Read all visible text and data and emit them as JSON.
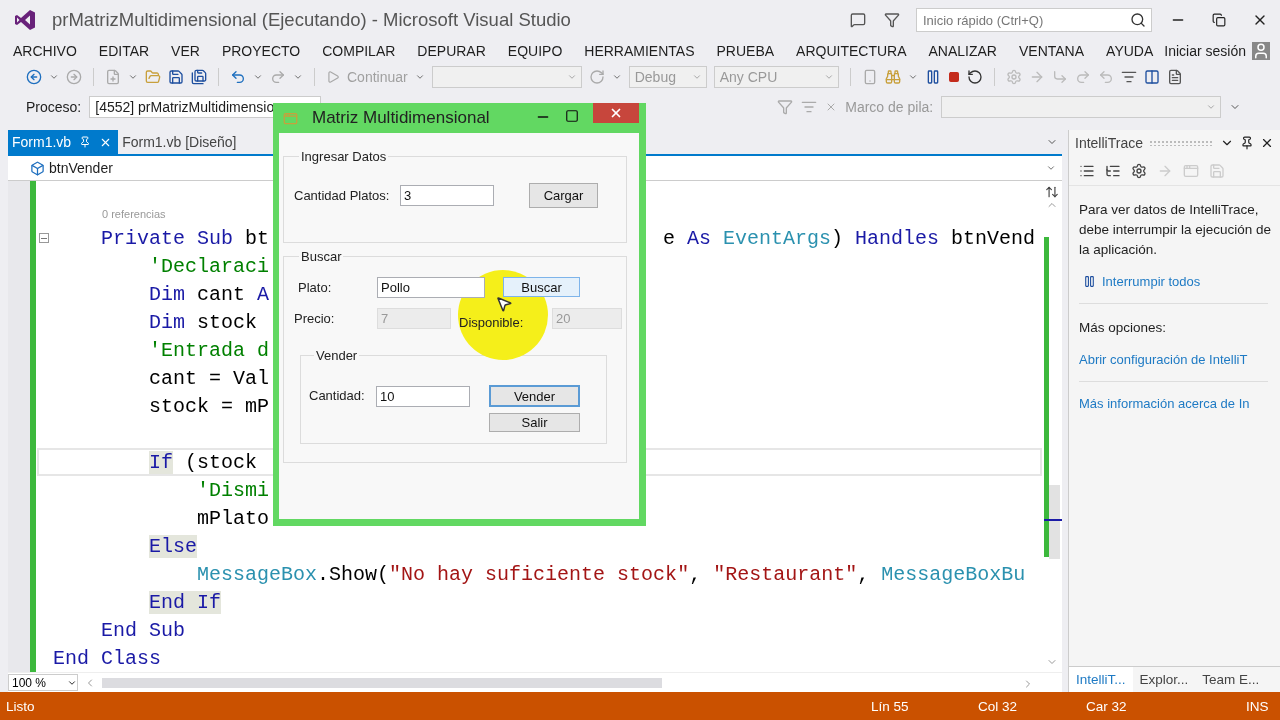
{
  "window": {
    "title": "prMatrizMultidimensional (Ejecutando) - Microsoft Visual Studio",
    "quick_launch": {
      "placeholder": "Inicio rápido (Ctrl+Q)"
    }
  },
  "menu": [
    "ARCHIVO",
    "EDITAR",
    "VER",
    "PROYECTO",
    "COMPILAR",
    "DEPURAR",
    "EQUIPO",
    "HERRAMIENTAS",
    "PRUEBA",
    "ARQUITECTURA",
    "ANALIZAR",
    "VENTANA",
    "AYUDA"
  ],
  "sign_in": "Iniciar sesión",
  "toolbar": {
    "continue": {
      "label": "Continuar",
      "disabled": true
    },
    "configuration": {
      "value": "Debug",
      "disabled": true
    },
    "platform": {
      "value": "Any CPU",
      "disabled": true
    }
  },
  "debug_bar": {
    "process_label": "Proceso:",
    "process": "[4552] prMatrizMultidimensio",
    "stack_label": "Marco de pila:"
  },
  "editor": {
    "tabs": [
      {
        "label": "Form1.vb",
        "selected": true
      },
      {
        "label": "Form1.vb [Diseño]",
        "selected": false
      }
    ],
    "member": "btnVender",
    "codelens": "0 referencias",
    "lines": [
      {
        "tokens": [
          {
            "kind": "keyword",
            "text": "    Private Sub "
          },
          {
            "kind": "plain",
            "text": "bt"
          }
        ],
        "tail": [
          {
            "kind": "plain",
            "text": "e "
          },
          {
            "kind": "keyword",
            "text": "As "
          },
          {
            "kind": "type",
            "text": "EventArgs"
          },
          {
            "kind": "plain",
            "text": ") "
          },
          {
            "kind": "keyword",
            "text": "Handles "
          },
          {
            "kind": "plain",
            "text": "btnVend"
          }
        ],
        "current": false,
        "foldable": true
      },
      {
        "tokens": [
          {
            "kind": "comment",
            "text": "        'Declaraci"
          }
        ],
        "current": false,
        "foldable": false
      },
      {
        "tokens": [
          {
            "kind": "keyword",
            "text": "        Dim "
          },
          {
            "kind": "plain",
            "text": "cant "
          },
          {
            "kind": "keyword",
            "text": "A"
          }
        ],
        "current": false,
        "foldable": false
      },
      {
        "tokens": [
          {
            "kind": "keyword",
            "text": "        Dim "
          },
          {
            "kind": "plain",
            "text": "stock"
          }
        ],
        "current": false,
        "foldable": false
      },
      {
        "tokens": [
          {
            "kind": "comment",
            "text": "        'Entrada d"
          }
        ],
        "current": false,
        "foldable": false
      },
      {
        "tokens": [
          {
            "kind": "plain",
            "text": "        cant = Val"
          }
        ],
        "current": false,
        "foldable": false
      },
      {
        "tokens": [
          {
            "kind": "plain",
            "text": "        stock = mP"
          }
        ],
        "current": false,
        "foldable": false
      },
      {
        "current": false,
        "foldable": false
      },
      {
        "tokens": [
          {
            "kind": "marked",
            "text": "        If"
          },
          {
            "kind": "plain",
            "text": " (stock"
          }
        ],
        "current": true,
        "foldable": false
      },
      {
        "tokens": [
          {
            "kind": "comment",
            "text": "            'Dismi"
          }
        ],
        "current": false,
        "foldable": false
      },
      {
        "tokens": [
          {
            "kind": "plain",
            "text": "            mPlato"
          }
        ],
        "current": false,
        "foldable": false
      },
      {
        "tokens": [
          {
            "kind": "marked",
            "text": "        Else"
          }
        ],
        "current": false,
        "foldable": false
      },
      {
        "tokens": [
          {
            "kind": "type",
            "text": "            MessageBox"
          },
          {
            "kind": "plain",
            "text": ".Show("
          },
          {
            "kind": "string",
            "text": "\"No hay suficiente stock\""
          },
          {
            "kind": "plain",
            "text": ", "
          },
          {
            "kind": "string",
            "text": "\"Restaurant\""
          },
          {
            "kind": "plain",
            "text": ", "
          },
          {
            "kind": "type",
            "text": "MessageBoxBu"
          }
        ],
        "current": false,
        "foldable": false
      },
      {
        "tokens": [
          {
            "kind": "marked",
            "text": "        End If"
          }
        ],
        "current": false,
        "foldable": false
      },
      {
        "tokens": [
          {
            "kind": "keyword",
            "text": "    End Sub"
          }
        ],
        "current": false,
        "foldable": false
      },
      {
        "tokens": [
          {
            "kind": "keyword",
            "text": "End Class"
          }
        ],
        "current": false,
        "foldable": false
      }
    ],
    "zoom": "100 %"
  },
  "intellitrace": {
    "title": "IntelliTrace",
    "message": "Para ver datos de IntelliTrace, debe interrumpir la ejecución de la aplicación.",
    "break_link": "Interrumpir todos",
    "more_label": "Más opciones:",
    "links": [
      "Abrir configuración de IntelliT",
      "Más información acerca de In"
    ],
    "tabs": [
      {
        "label": "IntelliT...",
        "selected": true
      },
      {
        "label": "Explor...",
        "selected": false
      },
      {
        "label": "Team E...",
        "selected": false
      }
    ]
  },
  "dialog": {
    "title": "Matriz Multidimensional",
    "input_group": {
      "title": "Ingresar Datos",
      "field": {
        "label": "Cantidad Platos:",
        "value": "3",
        "disabled": false
      },
      "button": {
        "label": "Cargar",
        "hovered": false,
        "default": false
      }
    },
    "search_group": {
      "title": "Buscar",
      "dish": {
        "label": "Plato:",
        "value": "Pollo",
        "disabled": false
      },
      "button": {
        "label": "Buscar",
        "hovered": true,
        "default": false
      },
      "price": {
        "label": "Precio:",
        "value": "7",
        "disabled": true
      },
      "stock": {
        "label": "Disponible:",
        "value": "20",
        "disabled": true
      },
      "sell_group": {
        "title": "Vender",
        "field": {
          "label": "Cantidad:",
          "value": "10",
          "disabled": false
        },
        "buttons": [
          {
            "label": "Vender",
            "hovered": false,
            "default": true
          },
          {
            "label": "Salir",
            "hovered": false,
            "default": false
          }
        ]
      }
    }
  },
  "status_bar": {
    "message": "Listo",
    "line": "Lín 55",
    "col": "Col 32",
    "char": "Car 32",
    "mode": "INS"
  }
}
